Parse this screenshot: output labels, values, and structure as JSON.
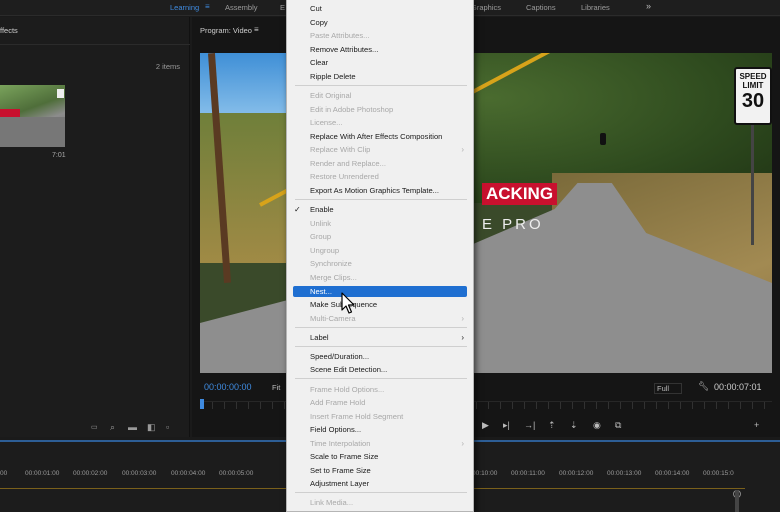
{
  "workspaces": [
    {
      "label": "Learning",
      "active": true
    },
    {
      "label": "Assembly",
      "active": false
    },
    {
      "label": "E",
      "active": false
    },
    {
      "label": "Graphics",
      "active": false
    },
    {
      "label": "Captions",
      "active": false
    },
    {
      "label": "Libraries",
      "active": false
    }
  ],
  "workspace_more": "»",
  "project_panel": {
    "tab_label": "ffects",
    "items_count": "2 items",
    "clip_duration": "7:01"
  },
  "program_monitor": {
    "title": "Program: Video",
    "timecode_current": "00:00:00:00",
    "fit_label": "Fit",
    "quality_label": "Full",
    "timecode_duration": "00:00:07:01",
    "overlay_title_red": "ACKING",
    "overlay_title_white": "E PRO",
    "sign_line1": "SPEED",
    "sign_line2": "LIMIT",
    "sign_number": "30"
  },
  "timeline": {
    "ticks": [
      "00",
      "00:00:01:00",
      "00:00:02:00",
      "00:00:03:00",
      "00:00:04:00",
      "00:00:05:00",
      "00:00:10:00",
      "00:00:11:00",
      "00:00:12:00",
      "00:00:13:00",
      "00:00:14:00",
      "00:00:15:0"
    ]
  },
  "context_menu": {
    "items": [
      {
        "label": "Cut",
        "disabled": false
      },
      {
        "label": "Copy",
        "disabled": false
      },
      {
        "label": "Paste Attributes...",
        "disabled": true
      },
      {
        "label": "Remove Attributes...",
        "disabled": false
      },
      {
        "label": "Clear",
        "disabled": false
      },
      {
        "label": "Ripple Delete",
        "disabled": false
      },
      {
        "label": "Edit Original",
        "disabled": true
      },
      {
        "label": "Edit in Adobe Photoshop",
        "disabled": true
      },
      {
        "label": "License...",
        "disabled": true
      },
      {
        "label": "Replace With After Effects Composition",
        "disabled": false
      },
      {
        "label": "Replace With Clip",
        "disabled": true
      },
      {
        "label": "Render and Replace...",
        "disabled": true
      },
      {
        "label": "Restore Unrendered",
        "disabled": true
      },
      {
        "label": "Export As Motion Graphics Template...",
        "disabled": false
      },
      {
        "label": "Enable",
        "disabled": false,
        "checked": true
      },
      {
        "label": "Unlink",
        "disabled": true
      },
      {
        "label": "Group",
        "disabled": true
      },
      {
        "label": "Ungroup",
        "disabled": true
      },
      {
        "label": "Synchronize",
        "disabled": true
      },
      {
        "label": "Merge Clips...",
        "disabled": true
      },
      {
        "label": "Nest...",
        "disabled": false,
        "highlighted": true
      },
      {
        "label": "Make Subsequence",
        "disabled": false
      },
      {
        "label": "Multi-Camera",
        "disabled": true
      },
      {
        "label": "Label",
        "disabled": false
      },
      {
        "label": "Speed/Duration...",
        "disabled": false
      },
      {
        "label": "Scene Edit Detection...",
        "disabled": false
      },
      {
        "label": "Frame Hold Options...",
        "disabled": true
      },
      {
        "label": "Add Frame Hold",
        "disabled": true
      },
      {
        "label": "Insert Frame Hold Segment",
        "disabled": true
      },
      {
        "label": "Field Options...",
        "disabled": false
      },
      {
        "label": "Time Interpolation",
        "disabled": true
      },
      {
        "label": "Scale to Frame Size",
        "disabled": false
      },
      {
        "label": "Set to Frame Size",
        "disabled": false
      },
      {
        "label": "Adjustment Layer",
        "disabled": false
      },
      {
        "label": "Link Media...",
        "disabled": true
      }
    ]
  },
  "colors": {
    "accent_blue": "#3f8be0",
    "menu_highlight": "#1f6fd1",
    "title_red": "#c8102e"
  }
}
